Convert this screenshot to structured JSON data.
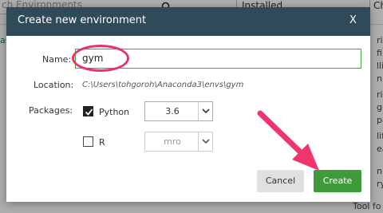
{
  "background": {
    "search_placeholder": "ch Environments",
    "search_icon": "search-icon",
    "filter_value": "Installed",
    "right_clip": "Ch",
    "left_snippet": "as",
    "right_fragments": [
      "ri",
      "fi",
      "lli",
      "n",
      "ri",
      "gu",
      "pa",
      "lif",
      "ea",
      "n",
      "ry"
    ],
    "tool_for": "Tool fo"
  },
  "dialog": {
    "title": "Create new environment",
    "close_label": "X",
    "name_label": "Name:",
    "name_value": "gym",
    "location_label": "Location:",
    "location_value": "C:\\Users\\tohgoroh\\Anaconda3\\envs\\gym",
    "packages_label": "Packages:",
    "packages": [
      {
        "name": "Python",
        "checked": true,
        "version": "3.6",
        "enabled": true
      },
      {
        "name": "R",
        "checked": false,
        "version": "mro",
        "enabled": false
      }
    ],
    "cancel_label": "Cancel",
    "create_label": "Create"
  },
  "annotation": {
    "highlight_color": "#e8336a",
    "accent_green": "#3f9a3a",
    "titlebar_color": "#2f4b5a"
  }
}
